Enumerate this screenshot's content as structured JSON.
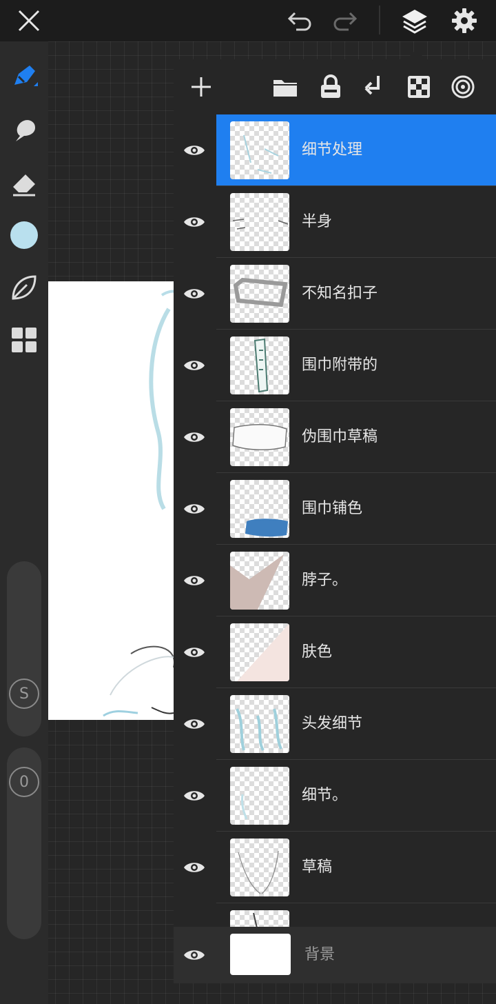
{
  "toolbar": {
    "close_icon": "close-icon",
    "undo_icon": "undo-arrow-icon",
    "redo_icon": "redo-arrow-icon",
    "layers_icon": "layers-stack-icon",
    "settings_icon": "gear-icon"
  },
  "sidebar": {
    "tools": [
      "brush-icon",
      "smudge-icon",
      "eraser-icon",
      "color-swatch",
      "leaf-icon",
      "grid-tiles-icon"
    ],
    "color_swatch": "#b9e0ee",
    "size_slider_label": "S",
    "opacity_slider_label": "0"
  },
  "layers_panel": {
    "tools": [
      "add-layer-icon",
      "folder-icon",
      "lock-icon",
      "merge-down-icon",
      "checkerboard-icon",
      "target-icon"
    ],
    "layers": [
      {
        "name": "细节处理",
        "active": true
      },
      {
        "name": "半身",
        "active": false
      },
      {
        "name": "不知名扣子",
        "active": false
      },
      {
        "name": "围巾附带的",
        "active": false
      },
      {
        "name": "伪围巾草稿",
        "active": false
      },
      {
        "name": "围巾铺色",
        "active": false
      },
      {
        "name": "脖子。",
        "active": false
      },
      {
        "name": "肤色",
        "active": false
      },
      {
        "name": "头发细节",
        "active": false
      },
      {
        "name": "细节。",
        "active": false
      },
      {
        "name": "草稿",
        "active": false
      }
    ],
    "background_layer": {
      "name": "背景"
    }
  },
  "colors": {
    "accent": "#1f7ff0",
    "panel": "#262626",
    "toolbar": "#1c1c1c"
  }
}
